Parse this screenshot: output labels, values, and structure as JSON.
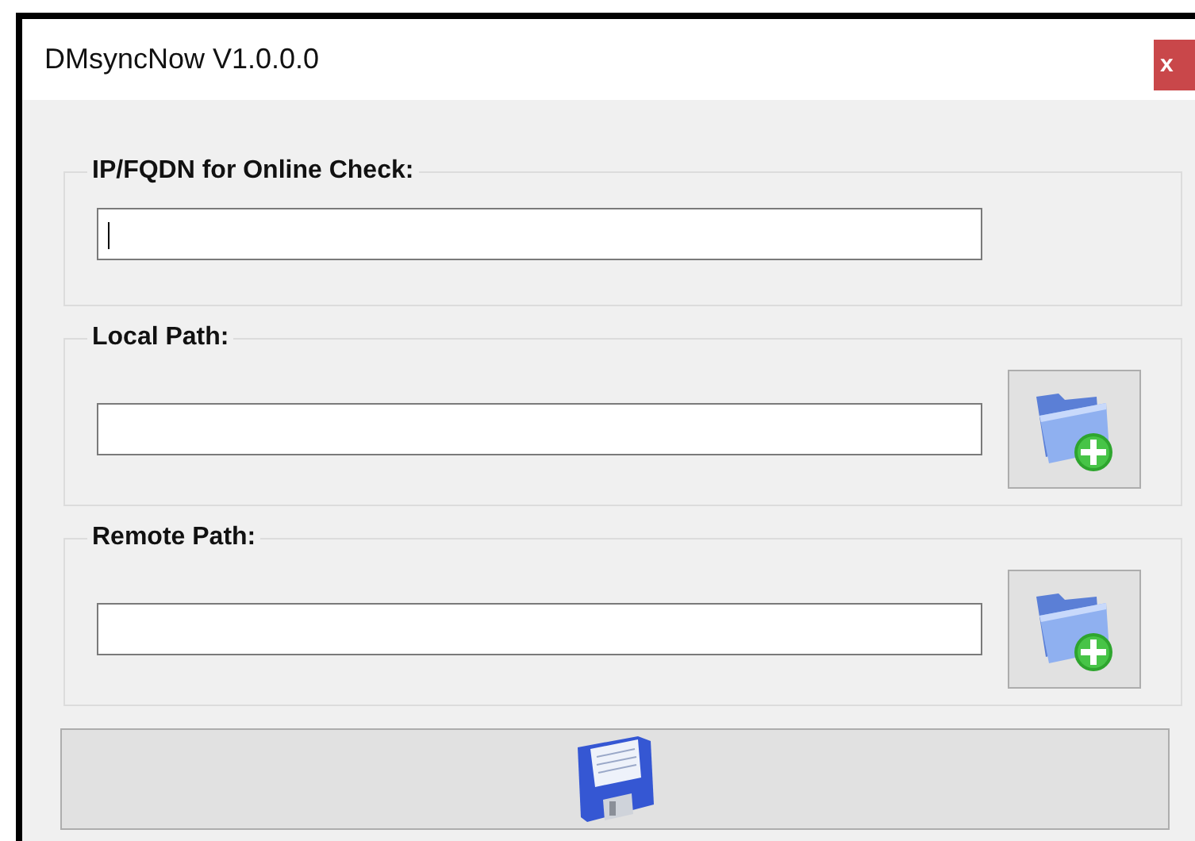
{
  "window": {
    "title": "DMsyncNow V1.0.0.0",
    "close_label": "x"
  },
  "groups": [
    {
      "kind": "text",
      "label": "IP/FQDN for Online Check:",
      "focused": true
    },
    {
      "kind": "browse",
      "label": "Local Path:",
      "focused": false
    },
    {
      "kind": "browse",
      "label": "Remote Path:",
      "focused": false
    }
  ]
}
